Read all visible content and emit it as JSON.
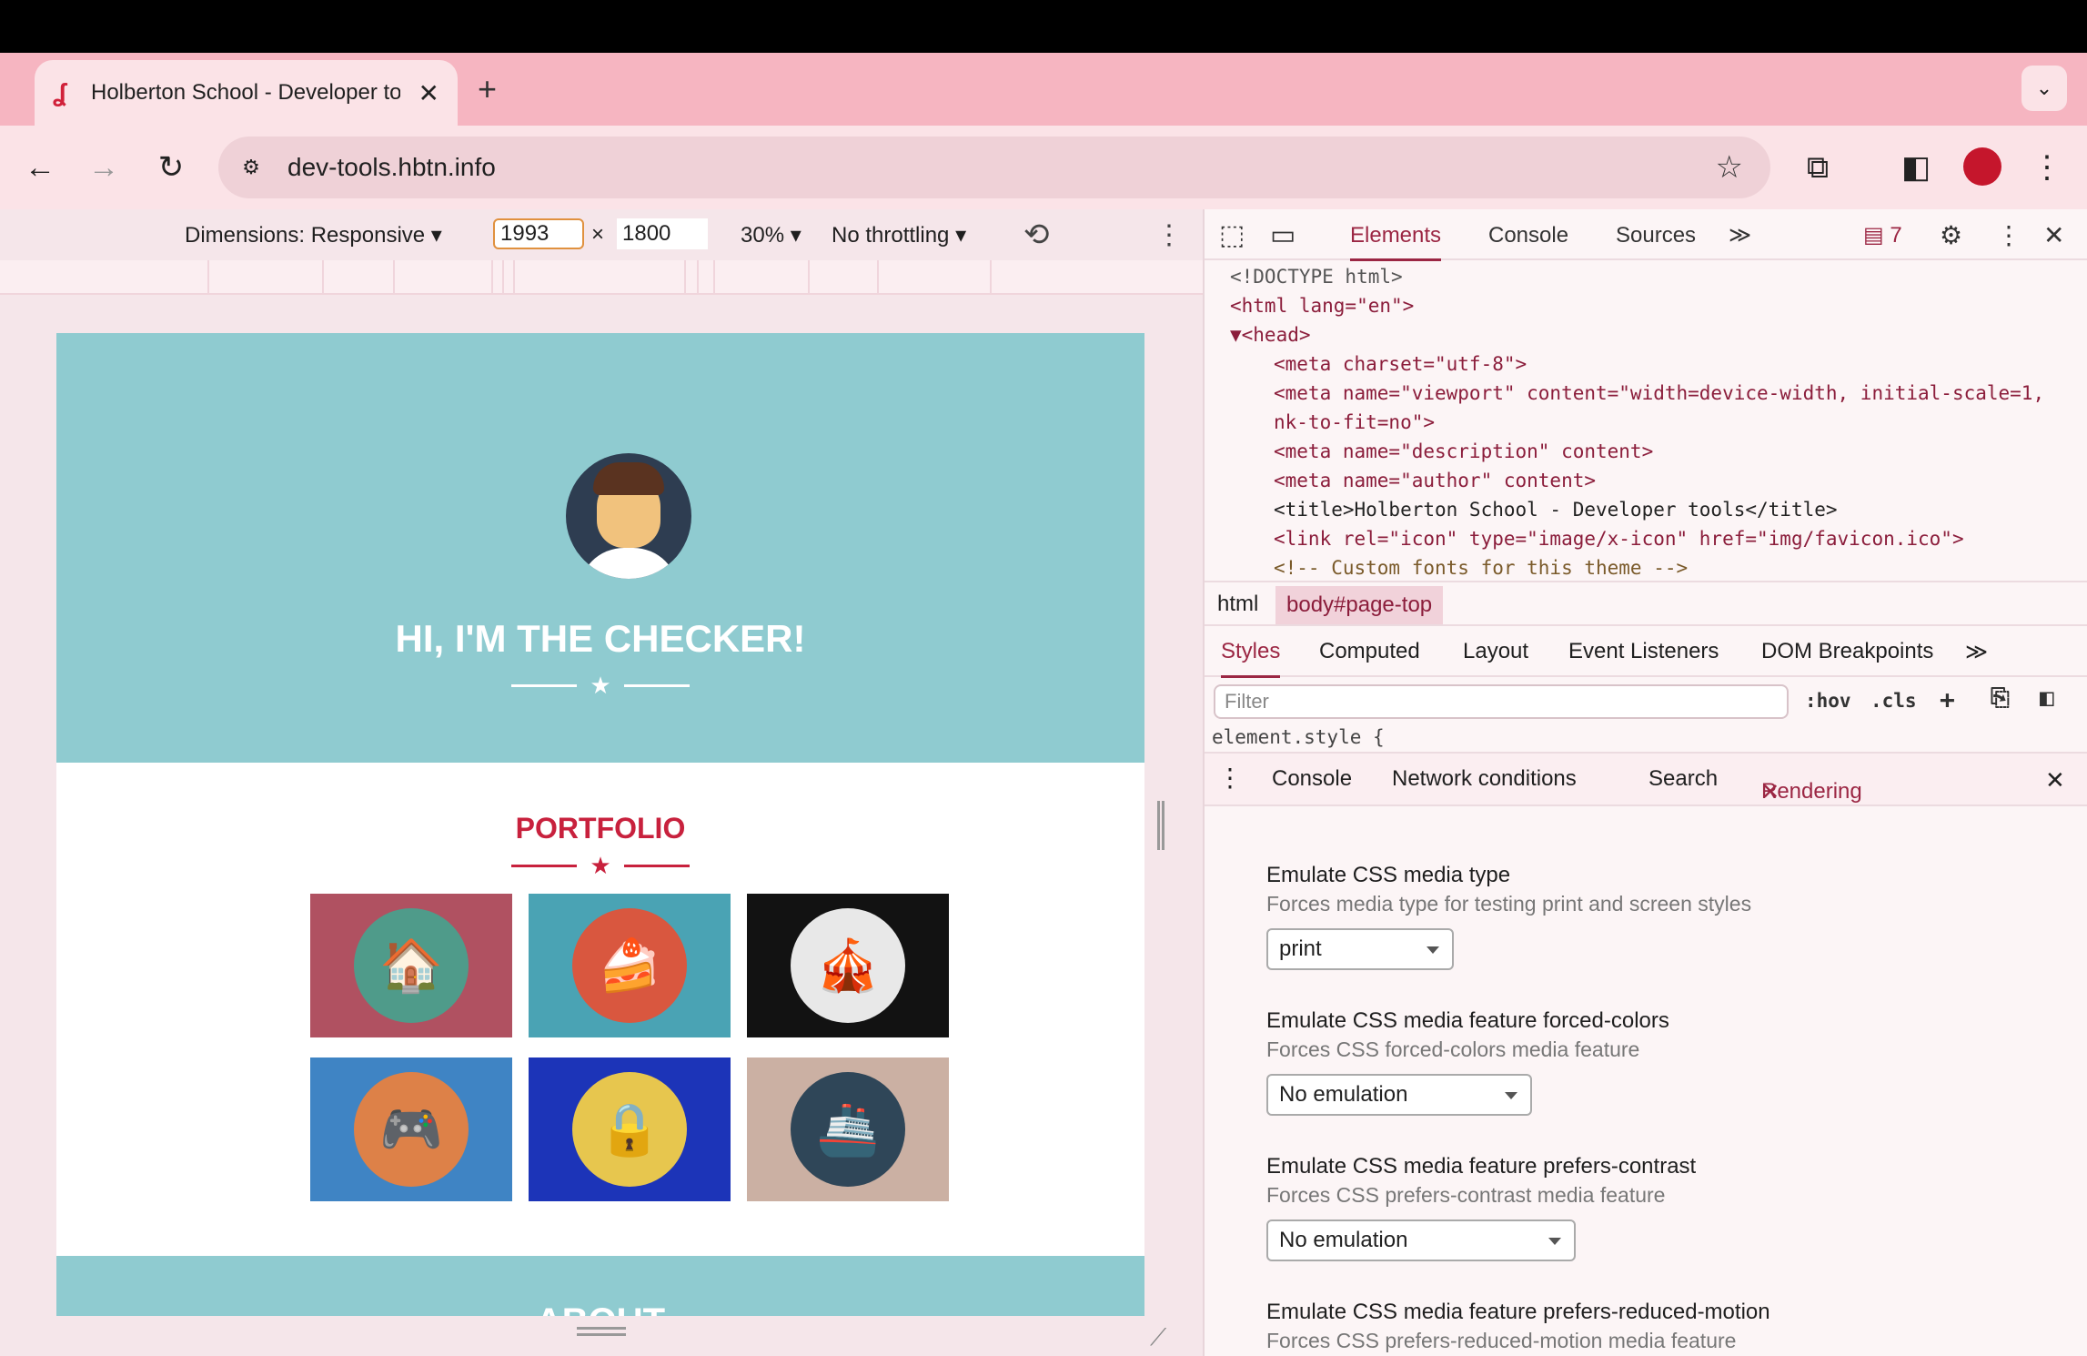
{
  "browser": {
    "tab_title": "Holberton School - Developer tools",
    "tab_favicon": "seahorse-icon",
    "url": "dev-tools.hbtn.info"
  },
  "device_toolbar": {
    "dimensions_label": "Dimensions: Responsive ▾",
    "width": "1993",
    "times": "×",
    "height": "1800",
    "zoom": "30% ▾",
    "throttling": "No throttling ▾"
  },
  "page": {
    "hero_title": "HI, I'M THE CHECKER!",
    "portfolio_title": "PORTFOLIO",
    "about_title": "ABOUT",
    "tiles": [
      {
        "bg": "#b05161",
        "disc": "#4f9b8a",
        "icon": "cabin-icon",
        "glyph": "🏠"
      },
      {
        "bg": "#4aa3b4",
        "disc": "#d9573f",
        "icon": "cake-icon",
        "glyph": "🍰"
      },
      {
        "bg": "#121212",
        "disc": "#e8e8e8",
        "icon": "circus-tent-icon",
        "glyph": "🎪"
      },
      {
        "bg": "#3f84c4",
        "disc": "#dd8148",
        "icon": "game-controller-icon",
        "glyph": "🎮"
      },
      {
        "bg": "#1c34b8",
        "disc": "#e7c64e",
        "icon": "safe-icon",
        "glyph": "🔒"
      },
      {
        "bg": "#cbb0a3",
        "disc": "#2f4658",
        "icon": "submarine-icon",
        "glyph": "🚢"
      }
    ]
  },
  "devtools": {
    "tabs": [
      "Elements",
      "Console",
      "Sources"
    ],
    "issues_count": "7",
    "dom_lines": [
      "<!DOCTYPE html>",
      "<html lang=\"en\">",
      "▼<head>",
      "<meta charset=\"utf-8\">",
      "<meta name=\"viewport\" content=\"width=device-width, initial-scale=1,",
      "nk-to-fit=no\">",
      "<meta name=\"description\" content>",
      "<meta name=\"author\" content>",
      "<title>Holberton School - Developer tools</title>",
      "<link rel=\"icon\" type=\"image/x-icon\" href=\"img/favicon.ico\">",
      "<!-- Custom fonts for this theme -->"
    ],
    "breadcrumbs": [
      "html",
      "body#page-top"
    ],
    "styles_tabs": [
      "Styles",
      "Computed",
      "Layout",
      "Event Listeners",
      "DOM Breakpoints"
    ],
    "filter_placeholder": "Filter",
    "hov": ":hov",
    "cls": ".cls",
    "element_style": "element.style {",
    "drawer_tabs": [
      "Console",
      "Network conditions",
      "Search",
      "Rendering"
    ],
    "rendering": [
      {
        "title": "Emulate CSS media type",
        "desc": "Forces media type for testing print and screen styles",
        "value": "print"
      },
      {
        "title": "Emulate CSS media feature forced-colors",
        "desc": "Forces CSS forced-colors media feature",
        "value": "No emulation"
      },
      {
        "title": "Emulate CSS media feature prefers-contrast",
        "desc": "Forces CSS prefers-contrast media feature",
        "value": "No emulation"
      },
      {
        "title": "Emulate CSS media feature prefers-reduced-motion",
        "desc": "Forces CSS prefers-reduced-motion media feature",
        "value": ""
      }
    ]
  }
}
